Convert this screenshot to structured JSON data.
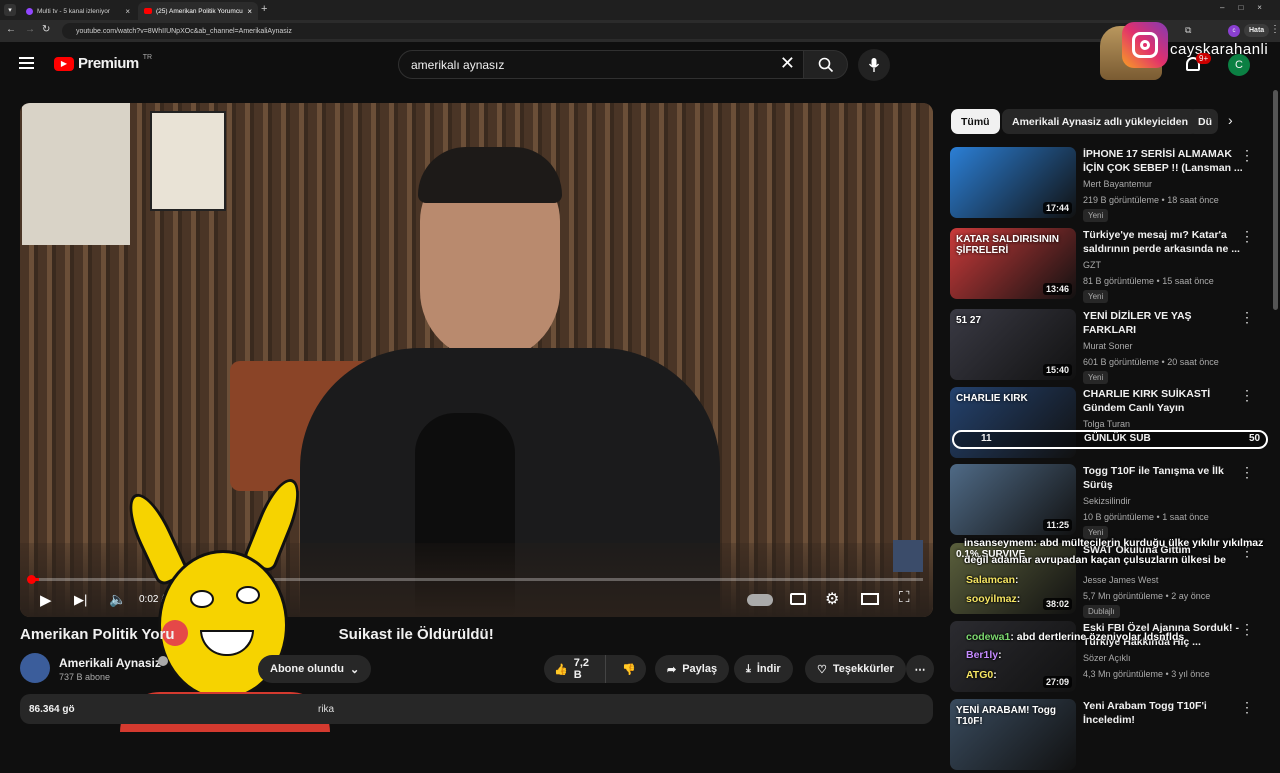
{
  "browser": {
    "tabs": [
      {
        "title": "Multi tv - 5 kanal izleniyor",
        "active": false
      },
      {
        "title": "(25) Amerikan Politik Yorumcu",
        "active": true
      }
    ],
    "url": "youtube.com/watch?v=8WhIIUNpXOc&ab_channel=AmerikaliAynasiz",
    "profile_label": "Hata"
  },
  "header": {
    "logo_text": "Premium",
    "logo_region": "TR",
    "search_value": "amerikalı aynasız",
    "notification_count": "9+",
    "avatar_letter": "C"
  },
  "overlay": {
    "streamer_name": "cayskarahanli",
    "sub_goal_left": "11",
    "sub_goal_label": "GÜNLÜK SUB",
    "sub_goal_right": "50",
    "chat": [
      {
        "user": "insanseymem",
        "text": ": abd mültecilerin kurduğu ülke yıkılır yıkılmaz",
        "color": "#ffffff"
      },
      {
        "user": "",
        "text": "değil adamlar avrupadan kaçan çulsuzların ülkesi be",
        "color": "#ffffff"
      },
      {
        "user": "Salamcan",
        "text": ":",
        "color": "#f6e663"
      },
      {
        "user": "sooyilmaz",
        "text": ":",
        "color": "#f6e663"
      },
      {
        "user": "codewa1",
        "text": ": abd dertlerine özeniyolar ldsnflds",
        "color": "#7cd86f"
      },
      {
        "user": "Ber1ly",
        "text": ":",
        "color": "#c58bff"
      },
      {
        "user": "ATG0",
        "text": ":",
        "color": "#f6e663"
      }
    ]
  },
  "player": {
    "time": "0:02 /",
    "progress": 0.01
  },
  "video": {
    "title_left": "Amerikan Politik Yoru",
    "title_right": "Suikast ile Öldürüldü!",
    "channel_name": "Amerikali Aynasiz",
    "subscribers": "737 B abone",
    "subscribed_label": "Abone olundu",
    "likes": "7,2 B",
    "share_label": "Paylaş",
    "download_label": "İndir",
    "thanks_label": "Teşekkürler",
    "views_partial": "86.364 gö",
    "desc_partial": "rika"
  },
  "sidebar": {
    "chips": [
      "Tümü",
      "Amerikali Aynasiz adlı yükleyiciden",
      "Dü"
    ],
    "items": [
      {
        "title": "İPHONE 17 SERİSİ ALMAMAK İÇİN ÇOK SEBEP !! (Lansman ...",
        "channel": "Mert Bayantemur",
        "meta": "219 B görüntüleme • 18 saat önce",
        "badge": "Yeni",
        "duration": "17:44",
        "thumb_color": "#2b7fd6"
      },
      {
        "title": "Türkiye'ye mesaj mı? Katar'a saldırının perde arkasında ne ...",
        "channel": "GZT",
        "meta": "81 B görüntüleme • 15 saat önce",
        "badge": "Yeni",
        "duration": "13:46",
        "thumb_color": "#c93a3a",
        "thumb_text": "KATAR SALDIRISININ ŞİFRELERİ"
      },
      {
        "title": "YENİ DİZİLER VE YAŞ FARKLARI",
        "channel": "Murat Soner",
        "meta": "601 B görüntüleme • 20 saat önce",
        "badge": "Yeni",
        "duration": "15:40",
        "thumb_color": "#3a3a44",
        "thumb_text": "51   27"
      },
      {
        "title": "CHARLIE KIRK SUİKASTİ Gündem Canlı Yayın",
        "channel": "Tolga Turan",
        "meta": "",
        "badge": "",
        "duration": "",
        "thumb_color": "#24426e",
        "thumb_text": "CHARLIE KIRK"
      },
      {
        "title": "Togg T10F ile Tanışma ve İlk Sürüş",
        "channel": "Sekizsilindir",
        "meta": "10 B görüntüleme • 1 saat önce",
        "badge": "Yeni",
        "duration": "11:25",
        "thumb_color": "#4f6a86"
      },
      {
        "title": "SWAT Okuluna Gittim",
        "channel": "Jesse James West",
        "meta": "5,7 Mn görüntüleme • 2 ay önce",
        "badge": "Dublajlı",
        "duration": "38:02",
        "thumb_color": "#5a5f3c",
        "thumb_text": "0.1% SURVIVE"
      },
      {
        "title": "Eski FBI Özel Ajanına Sorduk! - Türkiye Hakkında Hiç ...",
        "channel": "Sözer Açıklı",
        "meta": "4,3 Mn görüntüleme • 3 yıl önce",
        "badge": "",
        "duration": "27:09",
        "thumb_color": "#2b2b30"
      },
      {
        "title": "Yeni Arabam Togg T10F'i İnceledim!",
        "channel": "",
        "meta": "",
        "badge": "",
        "duration": "",
        "thumb_color": "#394b5e",
        "thumb_text": "YENİ ARABAM! Togg T10F!"
      }
    ]
  },
  "colors": {
    "accent_red": "#ff0000",
    "bg": "#0f0f0f",
    "chip": "#272727"
  }
}
